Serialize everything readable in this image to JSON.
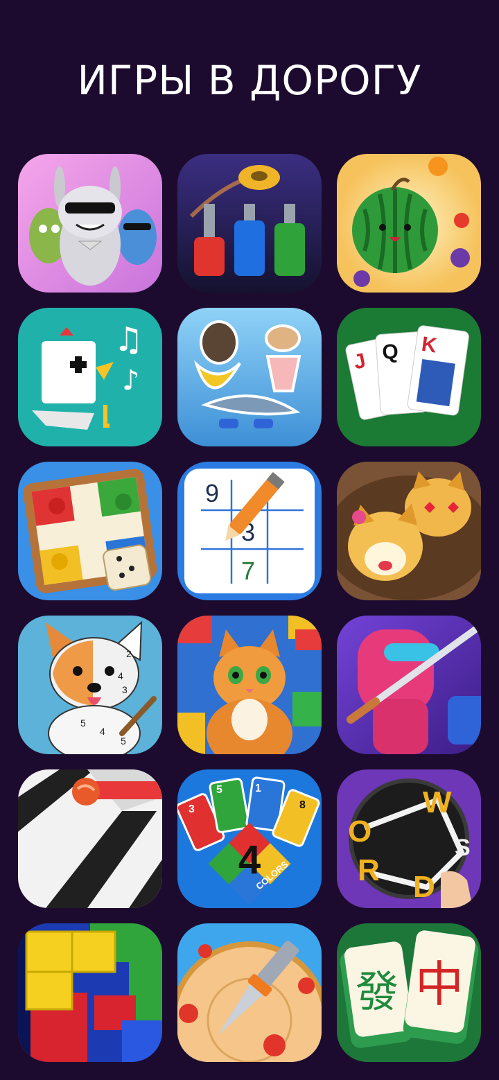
{
  "page": {
    "title": "ИГРЫ В ДОРОГУ"
  },
  "apps": [
    {
      "id": "monsters",
      "icon": "cartoon-bunny-monsters-icon",
      "colors": [
        "#f39be6",
        "#c06cd9"
      ]
    },
    {
      "id": "nuts-bolts",
      "icon": "nuts-and-bolts-icon",
      "colors": [
        "#3a2c7a",
        "#1b1640"
      ]
    },
    {
      "id": "fruit-merge",
      "icon": "watermelon-icon",
      "colors": [
        "#fde79a",
        "#f6c25c"
      ]
    },
    {
      "id": "chicken-music",
      "icon": "singing-chicken-icon",
      "colors": [
        "#1fb7ae",
        "#15918b"
      ]
    },
    {
      "id": "stickers",
      "icon": "meme-stickers-icon",
      "colors": [
        "#7fc8f3",
        "#3d8fd6"
      ]
    },
    {
      "id": "solitaire",
      "icon": "playing-cards-icon",
      "colors": [
        "#1d7a33",
        "#0f5622"
      ],
      "cards": [
        "J",
        "Q",
        "K"
      ]
    },
    {
      "id": "ludo",
      "icon": "ludo-board-icon",
      "colors": [
        "#3a90e8",
        "#1f63c5"
      ]
    },
    {
      "id": "sudoku",
      "icon": "sudoku-pencil-icon",
      "colors": [
        "#2f7fe6",
        "#1c5fcb"
      ],
      "digits": [
        "9",
        "3",
        "7"
      ]
    },
    {
      "id": "doge",
      "icon": "shiba-dogs-icon",
      "colors": [
        "#8b6242",
        "#5e3d26"
      ]
    },
    {
      "id": "corgi-paint",
      "icon": "corgi-color-by-number-icon",
      "colors": [
        "#5ab1d6",
        "#3a8fc0"
      ],
      "digits": [
        "2",
        "4",
        "3",
        "5",
        "4",
        "5"
      ]
    },
    {
      "id": "cat-jigsaw",
      "icon": "cat-jigsaw-icon",
      "colors": [
        "#2e6fd0",
        "#1b4ea8"
      ]
    },
    {
      "id": "katana",
      "icon": "impostor-katana-icon",
      "colors": [
        "#6a3fcf",
        "#3f1f8f"
      ]
    },
    {
      "id": "ball-run",
      "icon": "rolling-ball-icon",
      "colors": [
        "#f2f2f2",
        "#d8d8d8"
      ]
    },
    {
      "id": "four-colors",
      "icon": "uno-cards-icon",
      "colors": [
        "#1e7be0",
        "#0f4fa8"
      ],
      "labels": [
        "4",
        "COLORS",
        "3",
        "5",
        "1",
        "8"
      ]
    },
    {
      "id": "wordscapes",
      "icon": "word-connect-icon",
      "colors": [
        "#7a3fc2",
        "#4d2390"
      ],
      "letters": [
        "W",
        "O",
        "R",
        "D",
        "S"
      ]
    },
    {
      "id": "block-puzzle",
      "icon": "color-blocks-icon",
      "colors": [
        "#1d3bb5",
        "#0c1f7a"
      ]
    },
    {
      "id": "knife-hit",
      "icon": "knife-throw-icon",
      "colors": [
        "#4ab0ee",
        "#2278c7"
      ]
    },
    {
      "id": "mahjong",
      "icon": "mahjong-tiles-icon",
      "colors": [
        "#1f7a3c",
        "#0e4f22"
      ],
      "glyphs": [
        "發",
        "中"
      ]
    }
  ]
}
